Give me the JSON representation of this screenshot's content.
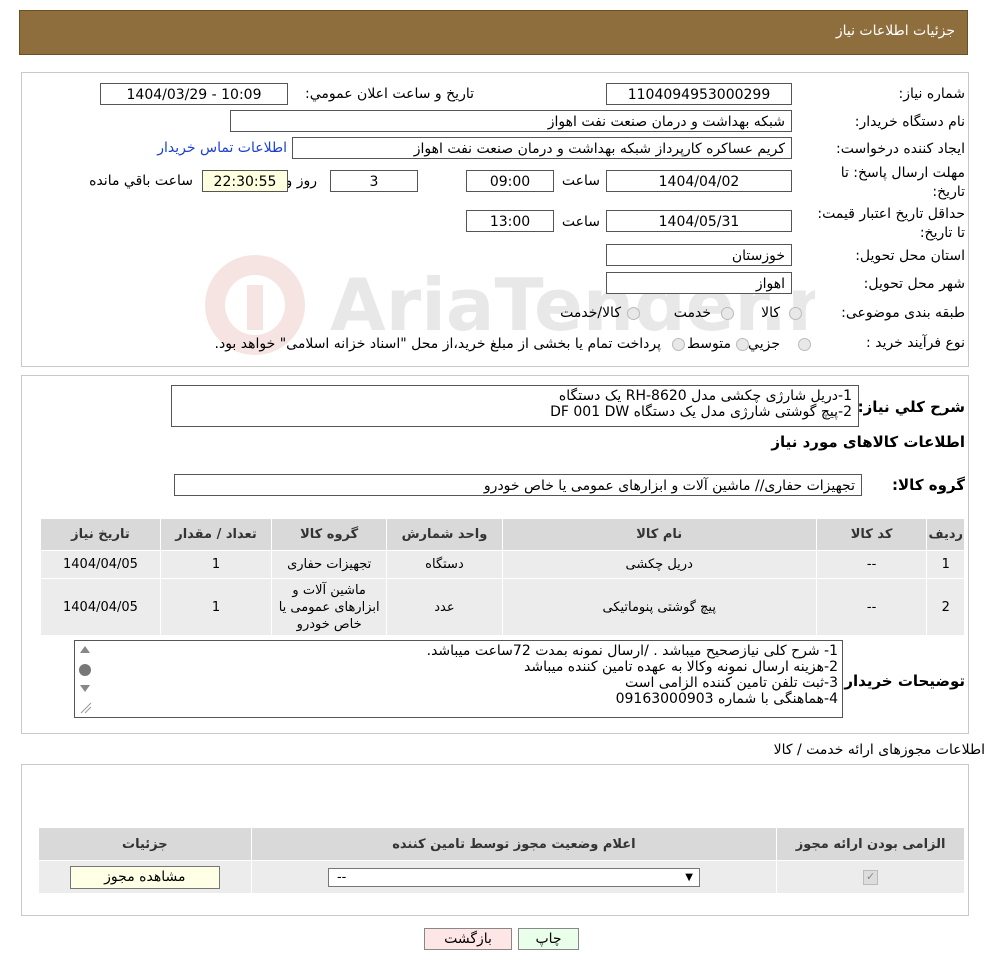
{
  "header": {
    "title": "جزئیات اطلاعات نیاز"
  },
  "fields": {
    "need_number_label": "شماره نیاز:",
    "need_number": "1104094953000299",
    "announce_label": "تاريخ و ساعت اعلان عمومي:",
    "announce_value": "1404/03/29 - 10:09",
    "buyer_org_label": "نام دستگاه خريدار:",
    "buyer_org": "شبکه بهداشت و درمان صنعت نفت اهواز",
    "creator_label": "ايجاد کننده درخواست:",
    "creator": "کریم عساکره کارپرداز شبکه بهداشت و درمان صنعت نفت اهواز",
    "contact_link": "اطلاعات تماس خريدار",
    "deadline_label": "مهلت ارسال پاسخ: تا تاريخ:",
    "deadline_date": "1404/04/02",
    "time_label": "ساعت",
    "deadline_time": "09:00",
    "days_value": "3",
    "days_label": "روز و",
    "remaining_time": "22:30:55",
    "remaining_label": "ساعت باقي مانده",
    "validity_label": "حداقل تاريخ اعتبار قيمت: تا تاريخ:",
    "validity_date": "1404/05/31",
    "validity_time": "13:00",
    "province_label": "استان محل تحويل:",
    "province": "خوزستان",
    "city_label": "شهر محل تحويل:",
    "city": "اهواز",
    "category_label": "طبقه بندی موضوعی:",
    "category_options": [
      "کالا",
      "خدمت",
      "کالا/خدمت"
    ],
    "process_label": "نوع فرآيند خريد :",
    "process_options": [
      "جزيي",
      "متوسط"
    ],
    "process_note": "پرداخت تمام يا بخشی از مبلغ خريد،از محل \"اسناد خزانه اسلامی\" خواهد بود."
  },
  "description": {
    "label": "شرح کلي نياز:",
    "line1": "1-دریل شارژی چکشی مدل RH-8620  یک دستگاه",
    "line2": "2-پیچ گوشتی شارژی مدل    یک دستگاه   DF 001 DW"
  },
  "goods": {
    "title": "اطلاعات کالاهای مورد نياز",
    "group_label": "گروه کالا:",
    "group_value": "تجهیزات حفاری// ماشین آلات و ابزارهای عمومی یا خاص خودرو",
    "columns": [
      "رديف",
      "کد کالا",
      "نام کالا",
      "واحد شمارش",
      "گروه کالا",
      "تعداد / مقدار",
      "تاريخ نياز"
    ],
    "rows": [
      {
        "idx": "1",
        "code": "--",
        "name": "دریل چکشی",
        "unit": "دستگاه",
        "group": "تجهیزات حفاری",
        "qty": "1",
        "date": "1404/04/05"
      },
      {
        "idx": "2",
        "code": "--",
        "name": "پیچ گوشتی پنوماتیکی",
        "unit": "عدد",
        "group": "ماشین آلات و ابزارهای عمومی یا خاص خودرو",
        "qty": "1",
        "date": "1404/04/05"
      }
    ]
  },
  "buyer_notes": {
    "label": "توضيحات خريدار:",
    "lines": [
      "1- شرح کلی نیازصحیح میباشد . /ارسال نمونه بمدت 72ساعت میباشد.",
      "2-هزینه ارسال نمونه وکالا به عهده تامین کننده میباشد",
      "3-ثبت تلفن تامین کننده الزامی است",
      "4-هماهنگی با شماره 09163000903"
    ]
  },
  "licenses": {
    "title": "اطلاعات مجوزهای ارائه خدمت / کالا",
    "columns": [
      "الزامی بودن ارائه مجوز",
      "اعلام وضعیت مجوز توسط تامین کننده",
      "جزئیات"
    ],
    "select_value": "--",
    "view_button": "مشاهده مجوز"
  },
  "buttons": {
    "print": "چاپ",
    "back": "بازگشت"
  },
  "watermark": {
    "text": "AriaTender.neT"
  },
  "colors": {
    "header": "#8f6e3e",
    "link": "#1a3fd6",
    "back_button": "#ffe6e6",
    "print_button": "#eaffea"
  }
}
